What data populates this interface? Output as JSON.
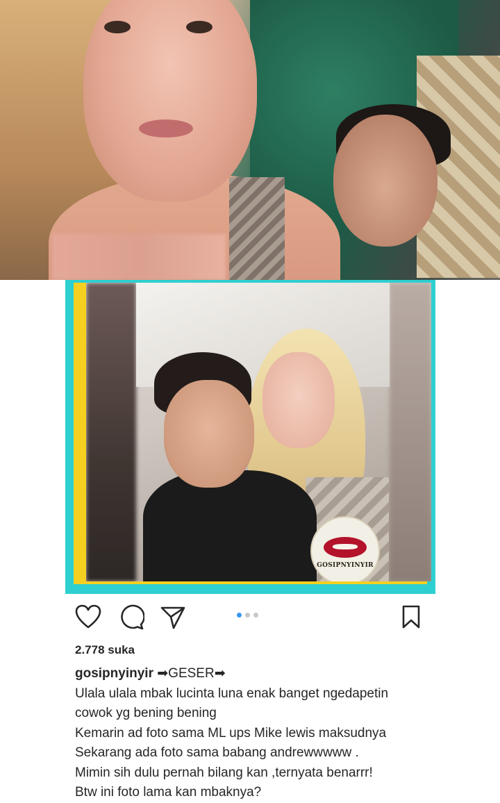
{
  "post": {
    "watermark_text": "GOSIPNYINYIR",
    "carousel": {
      "count": 3,
      "active_index": 0
    },
    "likes": "2.778 suka",
    "username": "gosipnyinyir",
    "caption_first": "➡GESER➡",
    "caption_lines": [
      "Ulala ulala mbak lucinta luna enak banget ngedapetin",
      "cowok yg bening bening",
      "Kemarin ad foto sama ML ups Mike lewis maksudnya",
      "Sekarang ada foto sama babang andrewwwww .",
      "Mimin sih dulu pernah bilang kan ,ternyata benarrr!",
      "Btw ini foto lama kan mbaknya?"
    ]
  },
  "icons": {
    "like": "heart-icon",
    "comment": "comment-icon",
    "share": "send-icon",
    "save": "bookmark-icon"
  },
  "colors": {
    "frame_outer": "#2ecfd0",
    "frame_inner": "#f5d020",
    "active_dot": "#3897f0"
  }
}
